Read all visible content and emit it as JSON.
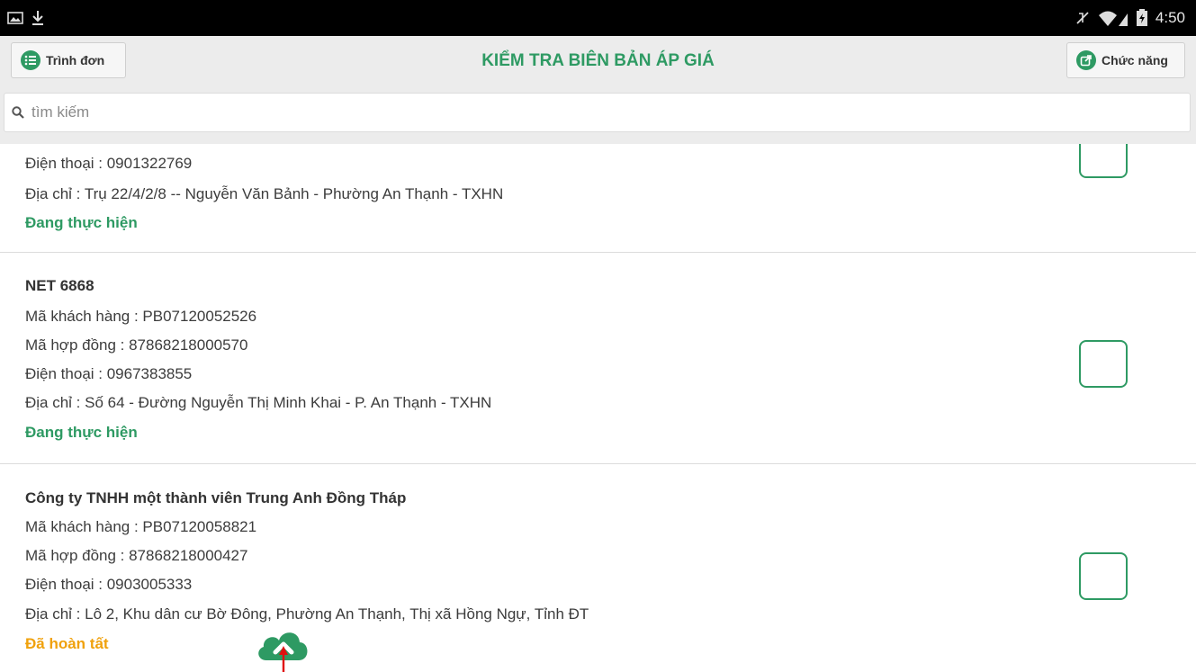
{
  "status_bar": {
    "time": "4:50"
  },
  "header": {
    "title": "KIỂM TRA BIÊN BẢN ÁP GIÁ",
    "menu_label": "Trình đơn",
    "function_label": "Chức năng"
  },
  "search": {
    "placeholder": "tìm kiếm",
    "value": ""
  },
  "items": [
    {
      "phone": "Điện thoại : 0901322769",
      "address": "Địa chỉ : Trụ 22/4/2/8 -- Nguyễn Văn Bảnh - Phường An Thạnh - TXHN",
      "status": "Đang thực hiện"
    },
    {
      "name": "NET 6868",
      "customer_code": "Mã khách hàng : PB07120052526",
      "contract_code": "Mã hợp đồng : 87868218000570",
      "phone": "Điện thoại : 0967383855",
      "address": "Địa chỉ : Số 64 - Đường Nguyễn Thị Minh Khai - P. An Thạnh - TXHN",
      "status": "Đang thực hiện"
    },
    {
      "name": "Công ty TNHH một thành viên Trung Anh Đồng Tháp",
      "customer_code": "Mã khách hàng : PB07120058821",
      "contract_code": "Mã hợp đồng : 87868218000427",
      "phone": "Điện thoại : 0903005333",
      "address": "Địa chỉ : Lô 2, Khu dân cư Bờ Đông, Phường An Thạnh, Thị xã Hồng Ngự, Tỉnh ĐT",
      "status": "Đã hoàn tất"
    }
  ],
  "icons": {
    "menu": "list-icon",
    "function": "share-icon",
    "search": "search-icon",
    "upload": "cloud-upload-icon"
  },
  "colors": {
    "accent": "#2e9a63",
    "status_done": "#f0a10c",
    "header_bg": "#ececec"
  }
}
